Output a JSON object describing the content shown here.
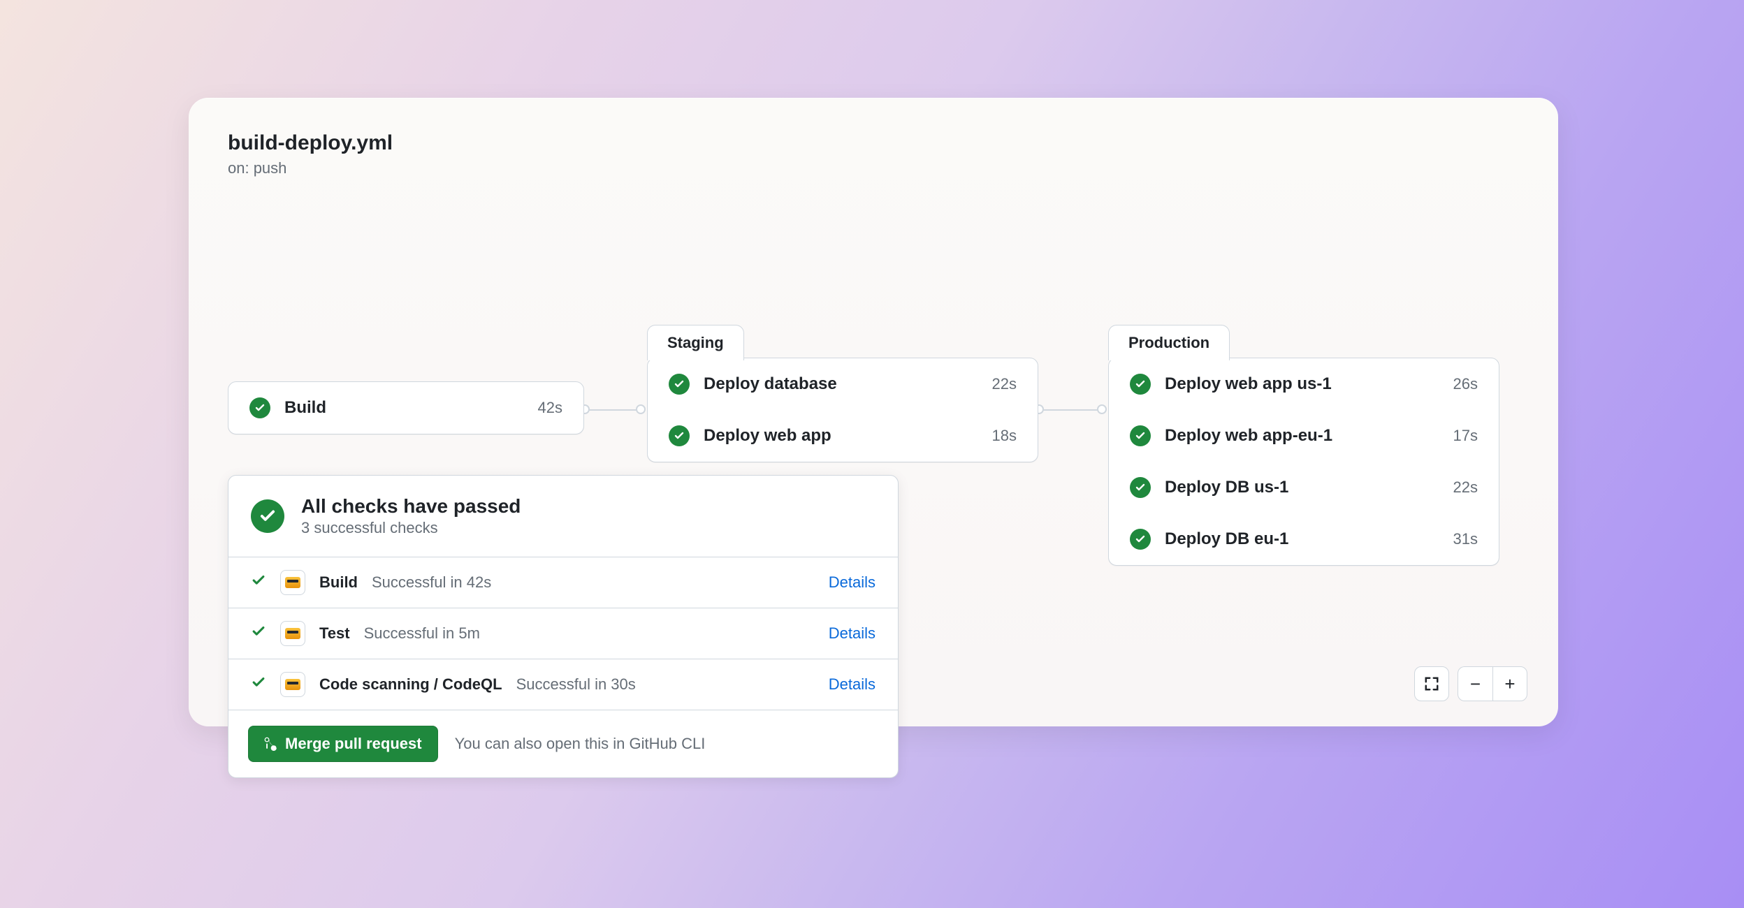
{
  "workflow": {
    "filename": "build-deploy.yml",
    "trigger": "on: push"
  },
  "stages": {
    "build": {
      "label": "Build",
      "time": "42s"
    },
    "staging": {
      "label": "Staging",
      "jobs": [
        {
          "name": "Deploy database",
          "time": "22s"
        },
        {
          "name": "Deploy web app",
          "time": "18s"
        }
      ]
    },
    "production": {
      "label": "Production",
      "jobs": [
        {
          "name": "Deploy web app us-1",
          "time": "26s"
        },
        {
          "name": "Deploy web app-eu-1",
          "time": "17s"
        },
        {
          "name": "Deploy DB us-1",
          "time": "22s"
        },
        {
          "name": "Deploy DB eu-1",
          "time": "31s"
        }
      ]
    }
  },
  "checks": {
    "title": "All checks have passed",
    "subtitle": "3 successful checks",
    "items": [
      {
        "name": "Build",
        "status": "Successful in 42s",
        "details": "Details"
      },
      {
        "name": "Test",
        "status": "Successful in 5m",
        "details": "Details"
      },
      {
        "name": "Code scanning / CodeQL",
        "status": "Successful in 30s",
        "details": "Details"
      }
    ],
    "merge_label": "Merge pull request",
    "cli_hint": "You can also open this in GitHub CLI"
  },
  "zoom": {
    "fullscreen": "⛶",
    "minus": "−",
    "plus": "+"
  }
}
